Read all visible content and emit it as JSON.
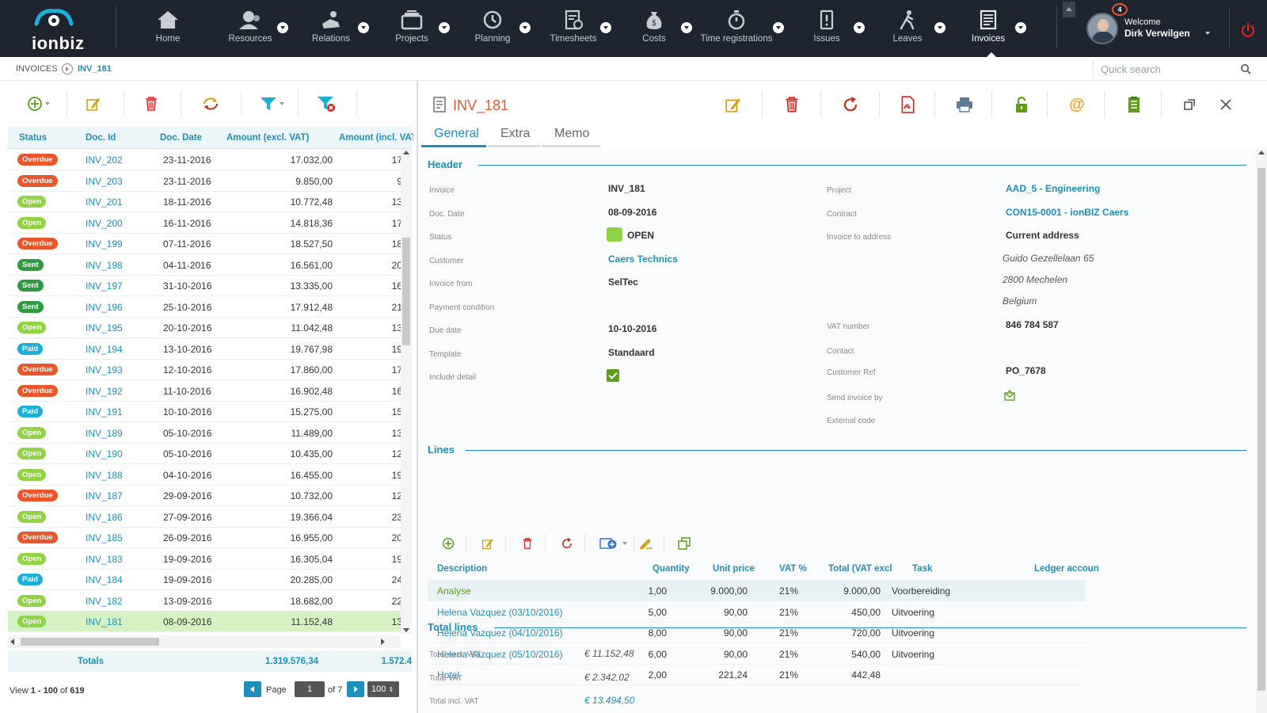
{
  "app": {
    "brand": "ionbiz"
  },
  "nav": [
    {
      "label": "Home",
      "icon": "home-icon"
    },
    {
      "label": "Resources",
      "icon": "resources-icon"
    },
    {
      "label": "Relations",
      "icon": "relations-icon"
    },
    {
      "label": "Projects",
      "icon": "projects-icon"
    },
    {
      "label": "Planning",
      "icon": "planning-icon"
    },
    {
      "label": "Timesheets",
      "icon": "timesheets-icon"
    },
    {
      "label": "Costs",
      "icon": "costs-icon"
    },
    {
      "label": "Time registrations",
      "icon": "time-registrations-icon"
    },
    {
      "label": "Issues",
      "icon": "issues-icon"
    },
    {
      "label": "Leaves",
      "icon": "leaves-icon"
    },
    {
      "label": "Invoices",
      "icon": "invoices-icon"
    }
  ],
  "user": {
    "notifications": "4",
    "welcome": "Welcome",
    "name": "Dirk Verwilgen"
  },
  "breadcrumb": {
    "section": "INVOICES",
    "current": "INV_181"
  },
  "search": {
    "placeholder": "Quick search"
  },
  "grid": {
    "columns": [
      "Status",
      "Doc. Id",
      "Doc. Date",
      "Amount (excl. VAT)",
      "Amount (incl. VAT"
    ],
    "rows": [
      {
        "status": "Overdue",
        "id": "INV_202",
        "date": "23-11-2016",
        "excl": "17.032,00",
        "incl": "17"
      },
      {
        "status": "Overdue",
        "id": "INV_203",
        "date": "23-11-2016",
        "excl": "9.850,00",
        "incl": "9"
      },
      {
        "status": "Open",
        "id": "INV_201",
        "date": "18-11-2016",
        "excl": "10.772,48",
        "incl": "13"
      },
      {
        "status": "Open",
        "id": "INV_200",
        "date": "16-11-2016",
        "excl": "14.818,36",
        "incl": "17"
      },
      {
        "status": "Overdue",
        "id": "INV_199",
        "date": "07-11-2016",
        "excl": "18.527,50",
        "incl": "18"
      },
      {
        "status": "Sent",
        "id": "INV_198",
        "date": "04-11-2016",
        "excl": "16.561,00",
        "incl": "20"
      },
      {
        "status": "Sent",
        "id": "INV_197",
        "date": "31-10-2016",
        "excl": "13.335,00",
        "incl": "16"
      },
      {
        "status": "Sent",
        "id": "INV_196",
        "date": "25-10-2016",
        "excl": "17.912,48",
        "incl": "21"
      },
      {
        "status": "Open",
        "id": "INV_195",
        "date": "20-10-2016",
        "excl": "11.042,48",
        "incl": "13"
      },
      {
        "status": "Paid",
        "id": "INV_194",
        "date": "13-10-2016",
        "excl": "19.767,98",
        "incl": "19"
      },
      {
        "status": "Overdue",
        "id": "INV_193",
        "date": "12-10-2016",
        "excl": "17.860,00",
        "incl": "17"
      },
      {
        "status": "Overdue",
        "id": "INV_192",
        "date": "11-10-2016",
        "excl": "16.902,48",
        "incl": "16"
      },
      {
        "status": "Paid",
        "id": "INV_191",
        "date": "10-10-2016",
        "excl": "15.275,00",
        "incl": "15"
      },
      {
        "status": "Open",
        "id": "INV_189",
        "date": "05-10-2016",
        "excl": "11.489,00",
        "incl": "13"
      },
      {
        "status": "Open",
        "id": "INV_190",
        "date": "05-10-2016",
        "excl": "10.435,00",
        "incl": "12"
      },
      {
        "status": "Open",
        "id": "INV_188",
        "date": "04-10-2016",
        "excl": "16.455,00",
        "incl": "19"
      },
      {
        "status": "Overdue",
        "id": "INV_187",
        "date": "29-09-2016",
        "excl": "10.732,00",
        "incl": "12"
      },
      {
        "status": "Open",
        "id": "INV_186",
        "date": "27-09-2016",
        "excl": "19.366,04",
        "incl": "23"
      },
      {
        "status": "Overdue",
        "id": "INV_185",
        "date": "26-09-2016",
        "excl": "16.955,00",
        "incl": "20"
      },
      {
        "status": "Open",
        "id": "INV_183",
        "date": "19-09-2016",
        "excl": "16.305,04",
        "incl": "19"
      },
      {
        "status": "Paid",
        "id": "INV_184",
        "date": "19-09-2016",
        "excl": "20.285,00",
        "incl": "24"
      },
      {
        "status": "Open",
        "id": "INV_182",
        "date": "13-09-2016",
        "excl": "18.682,00",
        "incl": "22"
      },
      {
        "status": "Open",
        "id": "INV_181",
        "date": "08-09-2016",
        "excl": "11.152,48",
        "incl": "13",
        "selected": true
      }
    ],
    "totals": {
      "label": "Totals",
      "excl": "1.319.576,34",
      "incl": "1.572.4"
    },
    "pager": {
      "view": "View ",
      "range": "1 - 100",
      "of": " of ",
      "count": "619",
      "page_label": "Page",
      "page": "1",
      "of_pages": "of 7",
      "page_size": "100"
    }
  },
  "status_colors": {
    "Overdue": "#e8562a",
    "Open": "#8ed444",
    "Sent": "#2f9a3e",
    "Paid": "#1cb0d8"
  },
  "detail": {
    "title": "INV_181",
    "tabs": [
      "General",
      "Extra",
      "Memo"
    ],
    "header_section": "Header",
    "left_fields": [
      {
        "label": "Invoice",
        "value": "INV_181"
      },
      {
        "label": "Doc. Date",
        "value": "08-09-2016"
      },
      {
        "label": "Status",
        "value": "OPEN"
      },
      {
        "label": "Customer",
        "value": "Caers Technics"
      },
      {
        "label": "Invoice from",
        "value": "SelTec"
      },
      {
        "label": "Payment condition",
        "value": ""
      },
      {
        "label": "Due date",
        "value": "10-10-2016"
      },
      {
        "label": "Template",
        "value": "Standaard"
      },
      {
        "label": "Include detail",
        "value": ""
      }
    ],
    "right_fields": [
      {
        "label": "Project",
        "value": "AAD_5 - Engineering"
      },
      {
        "label": "Contract",
        "value": "CON15-0001 - ionBIZ Caers"
      },
      {
        "label": "Invoice to address",
        "value": "Current address"
      },
      {
        "label": "",
        "value": "Guido Gezellelaan 65"
      },
      {
        "label": "",
        "value": "2800 Mechelen"
      },
      {
        "label": "",
        "value": "Belgium"
      },
      {
        "label": "VAT number",
        "value": "846 784 587"
      },
      {
        "label": "Contact",
        "value": ""
      },
      {
        "label": "Customer Ref",
        "value": "PO_7678"
      },
      {
        "label": "Send invoice by",
        "value": ""
      },
      {
        "label": "External code",
        "value": ""
      }
    ],
    "lines_section": "Lines",
    "lines_columns": [
      "Description",
      "Quantity",
      "Unit price",
      "VAT %",
      "Total (VAT excl",
      "Task",
      "Ledger accoun"
    ],
    "lines": [
      {
        "desc": "Analyse",
        "qty": "1,00",
        "price": "9.000,00",
        "vat": "21%",
        "total": "9.000,00",
        "task": "Voorbereiding",
        "ledger": ""
      },
      {
        "desc": "Helena Vazquez (03/10/2016)",
        "qty": "5,00",
        "price": "90,00",
        "vat": "21%",
        "total": "450,00",
        "task": "Uitvoering",
        "ledger": ""
      },
      {
        "desc": "Helena Vazquez (04/10/2016)",
        "qty": "8,00",
        "price": "90,00",
        "vat": "21%",
        "total": "720,00",
        "task": "Uitvoering",
        "ledger": ""
      },
      {
        "desc": "Helena Vazquez (05/10/2016)",
        "qty": "6,00",
        "price": "90,00",
        "vat": "21%",
        "total": "540,00",
        "task": "Uitvoering",
        "ledger": ""
      },
      {
        "desc": "Hotel",
        "qty": "2,00",
        "price": "221,24",
        "vat": "21%",
        "total": "442,48",
        "task": "",
        "ledger": ""
      }
    ],
    "total_section": "Total lines",
    "totals": [
      {
        "label": "Total excl. VAT",
        "value": "€ 11.152,48"
      },
      {
        "label": "Total VAT",
        "value": "€ 2.342,02"
      },
      {
        "label": "Total incl. VAT",
        "value": "€ 13.494,50"
      }
    ]
  }
}
